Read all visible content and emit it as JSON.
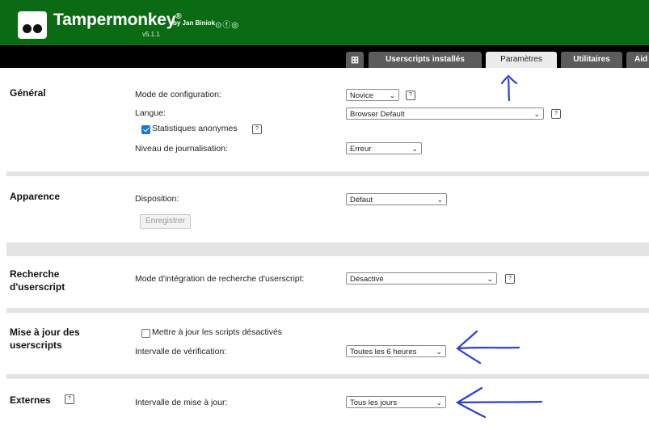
{
  "header": {
    "app_name": "Tampermonkey",
    "registered": "®",
    "version": "v5.1.1",
    "byline": "by Jan Biniok",
    "social_icons": [
      "github-icon",
      "facebook-icon",
      "instagram-icon"
    ],
    "social_glyphs": "⊙ⓕ◎",
    "brand_color": "#0a6b14"
  },
  "tabs": {
    "new_script_icon": "⊞",
    "installed": "Userscripts installés",
    "settings": "Paramètres",
    "utilities": "Utilitaires",
    "more": "Aid"
  },
  "sections": {
    "general": {
      "title": "Général",
      "config_mode_label": "Mode de configuration:",
      "config_mode_value": "Novice",
      "language_label": "Langue:",
      "language_value": "Browser Default",
      "anon_stats_label": "Statistiques anonymes",
      "anon_stats_checked": true,
      "log_level_label": "Niveau de journalisation:",
      "log_level_value": "Erreur"
    },
    "appearance": {
      "title": "Apparence",
      "layout_label": "Disposition:",
      "layout_value": "Défaut",
      "save_button": "Enregistrer"
    },
    "search": {
      "title_line1": "Recherche",
      "title_line2": "d'userscript",
      "integration_label": "Mode d'intégration de recherche d'userscript:",
      "integration_value": "Désactivé"
    },
    "update": {
      "title_line1": "Mise à jour des",
      "title_line2": "userscripts",
      "update_disabled_label": "Mettre à jour les scripts désactivés",
      "update_disabled_checked": false,
      "check_interval_label": "Intervalle de vérification:",
      "check_interval_value": "Toutes les 6 heures"
    },
    "externals": {
      "title": "Externes",
      "update_interval_label": "Intervalle de mise à jour:",
      "update_interval_value": "Tous les jours"
    }
  },
  "glyphs": {
    "help": "?",
    "chevron": "⌄"
  },
  "annotation_color": "#2c3fd6"
}
